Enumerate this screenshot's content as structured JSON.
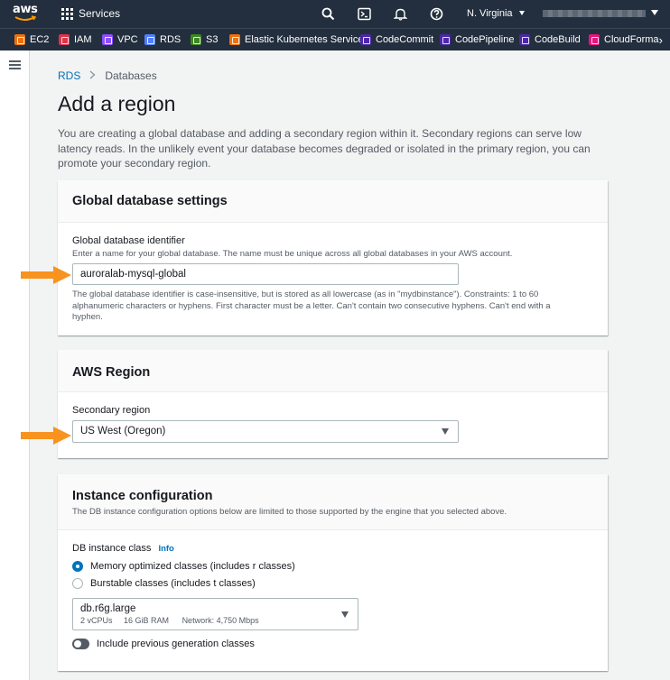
{
  "topnav": {
    "services_label": "Services",
    "region_label": "N. Virginia"
  },
  "favorites": [
    {
      "label": "EC2",
      "color": "#ec7211"
    },
    {
      "label": "IAM",
      "color": "#dd344c"
    },
    {
      "label": "VPC",
      "color": "#8c4fff"
    },
    {
      "label": "RDS",
      "color": "#527fff"
    },
    {
      "label": "S3",
      "color": "#3f8624"
    },
    {
      "label": "Elastic Kubernetes Service",
      "color": "#ec7211"
    },
    {
      "label": "CodeCommit",
      "color": "#4d27aa"
    },
    {
      "label": "CodePipeline",
      "color": "#4d27aa"
    },
    {
      "label": "CodeBuild",
      "color": "#4d27aa"
    },
    {
      "label": "CloudForma",
      "color": "#e7157b"
    }
  ],
  "breadcrumb": {
    "root": "RDS",
    "current": "Databases"
  },
  "page": {
    "title": "Add a region",
    "intro": "You are creating a global database and adding a secondary region within it. Secondary regions can serve low latency reads. In the unlikely event your database becomes degraded or isolated in the primary region, you can promote your secondary region."
  },
  "global_settings": {
    "heading": "Global database settings",
    "field_label": "Global database identifier",
    "field_hint": "Enter a name for your global database. The name must be unique across all global databases in your AWS account.",
    "field_value": "auroralab-mysql-global",
    "constraint": "The global database identifier is case-insensitive, but is stored as all lowercase (as in \"mydbinstance\"). Constraints: 1 to 60 alphanumeric characters or hyphens. First character must be a letter. Can't contain two consecutive hyphens. Can't end with a hyphen."
  },
  "aws_region": {
    "heading": "AWS Region",
    "field_label": "Secondary region",
    "selected": "US West (Oregon)"
  },
  "instance_config": {
    "heading": "Instance configuration",
    "description": "The DB instance configuration options below are limited to those supported by the engine that you selected above.",
    "class_label": "DB instance class",
    "info_label": "Info",
    "options": [
      {
        "label": "Memory optimized classes (includes r classes)",
        "selected": true
      },
      {
        "label": "Burstable classes (includes t classes)",
        "selected": false
      }
    ],
    "instance_selected": "db.r6g.large",
    "instance_specs": {
      "vcpus": "2 vCPUs",
      "ram": "16 GiB RAM",
      "network": "Network: 4,750 Mbps"
    },
    "prev_gen_label": "Include previous generation classes",
    "prev_gen_enabled": false
  },
  "colors": {
    "nav_bg": "#232f3e",
    "link": "#0073bb",
    "arrow": "#f7931e",
    "page_bg": "#f2f3f3"
  }
}
